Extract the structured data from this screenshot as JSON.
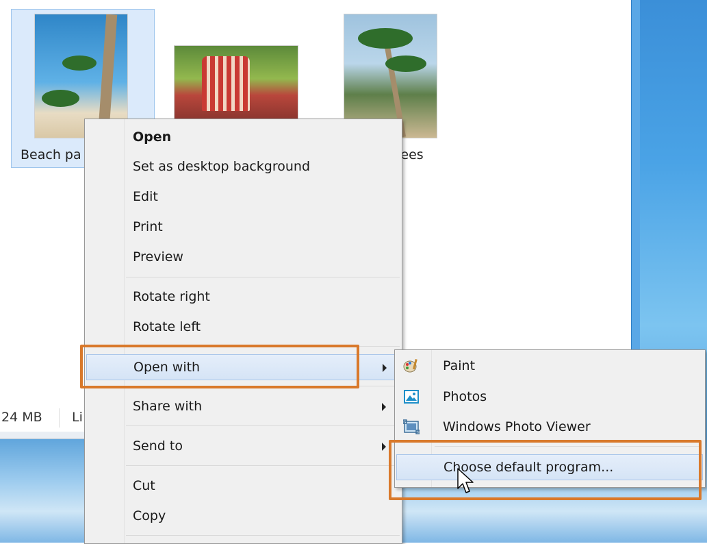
{
  "files": [
    {
      "label": "Beach pa",
      "name": "beach-palm"
    },
    {
      "label": "",
      "name": "beach-chair"
    },
    {
      "label": "rees",
      "name": "palm-trees"
    }
  ],
  "status": {
    "size": "24 MB",
    "more": "Li"
  },
  "context_menu": {
    "items": [
      {
        "label": "Open",
        "bold": true
      },
      {
        "label": "Set as desktop background"
      },
      {
        "label": "Edit"
      },
      {
        "label": "Print"
      },
      {
        "label": "Preview"
      },
      {
        "label": "Rotate right"
      },
      {
        "label": "Rotate left"
      },
      {
        "label": "Open with",
        "submenu": true,
        "highlighted": true
      },
      {
        "label": "Share with",
        "submenu": true
      },
      {
        "label": "Send to",
        "submenu": true
      },
      {
        "label": "Cut"
      },
      {
        "label": "Copy"
      }
    ]
  },
  "open_with_submenu": {
    "items": [
      {
        "label": "Paint",
        "icon": "paint-icon"
      },
      {
        "label": "Photos",
        "icon": "photos-icon"
      },
      {
        "label": "Windows Photo Viewer",
        "icon": "photo-viewer-icon"
      },
      {
        "label": "Choose default program...",
        "highlighted": true
      }
    ]
  },
  "colors": {
    "callout": "#d9792b",
    "highlight": "#d5e4f6"
  }
}
